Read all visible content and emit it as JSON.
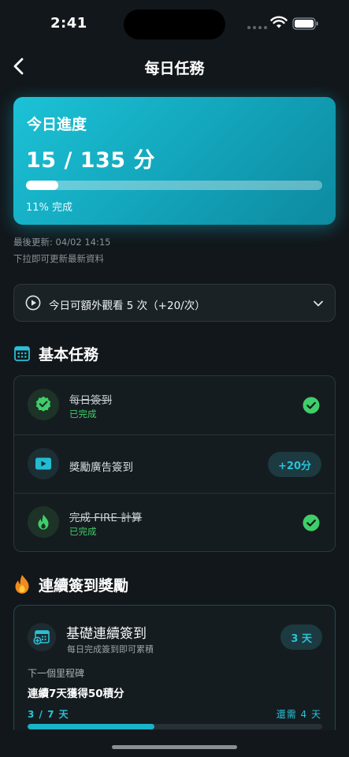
{
  "status_bar": {
    "time": "2:41"
  },
  "nav": {
    "title": "每日任務"
  },
  "progress": {
    "title": "今日進度",
    "score_text": "15 / 135 分",
    "fill_percent": 11,
    "percent_text": "11% 完成"
  },
  "update": {
    "last_updated": "最後更新: 04/02 14:15",
    "hint": "下拉即可更新最新資料"
  },
  "extra_watch": {
    "label": "今日可額外觀看 5 次（+20/次）"
  },
  "basic_tasks": {
    "heading": "基本任務",
    "items": [
      {
        "title": "每日簽到",
        "status": "已完成"
      },
      {
        "title": "獎勵廣告簽到",
        "reward": "+20分"
      },
      {
        "title": "完成 FIRE 計算",
        "status": "已完成"
      }
    ]
  },
  "streak": {
    "heading": "連續簽到獎勵",
    "card": {
      "title": "基礎連續簽到",
      "subtitle": "每日完成簽到即可累積",
      "days_badge": "3 天",
      "next_label": "下一個里程碑",
      "goal": "連續7天獲得50積分",
      "progress_text": "3 / 7 天",
      "remaining": "還需 4 天",
      "fill_fraction": 0.43
    }
  },
  "colors": {
    "accent": "#28c3d8",
    "success": "#3fce6a",
    "background": "#12171b"
  }
}
